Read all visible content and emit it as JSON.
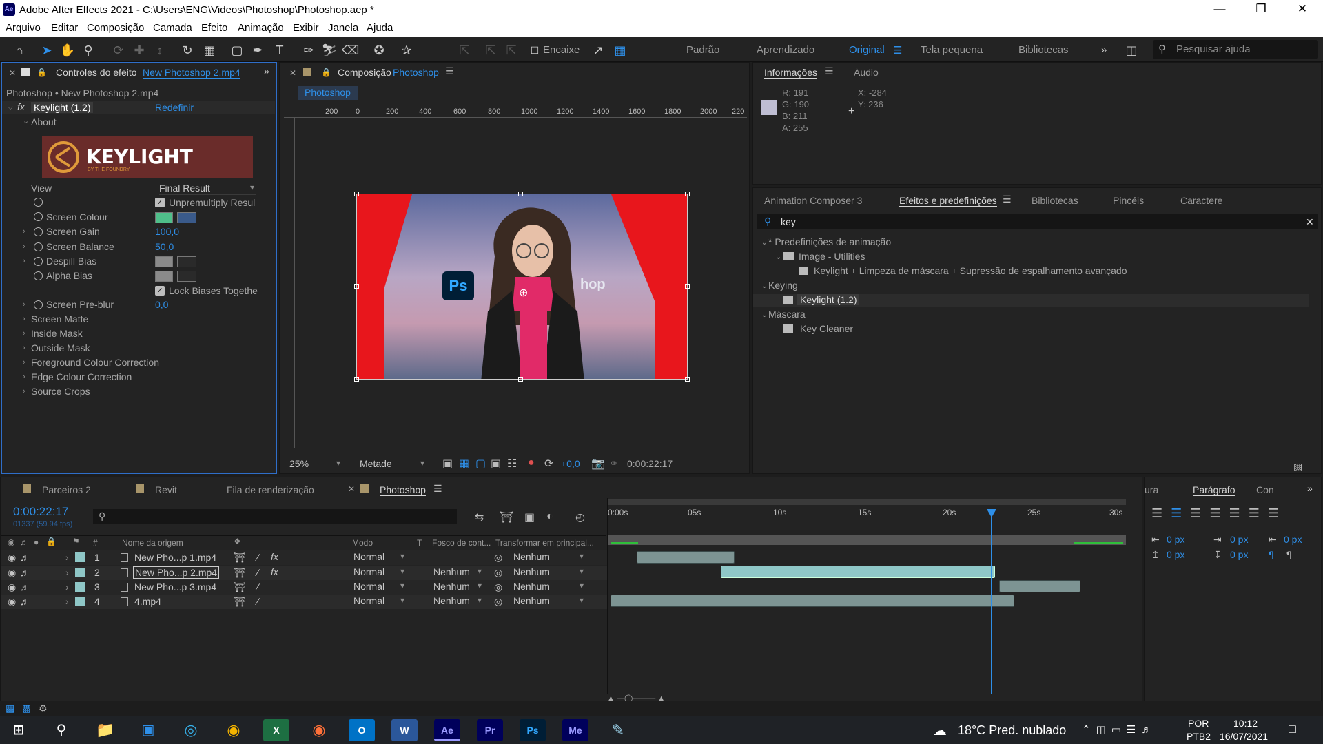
{
  "window": {
    "title": "Adobe After Effects 2021 - C:\\Users\\ENG\\Videos\\Photoshop\\Photoshop.aep *",
    "app_icon": "Ae"
  },
  "menu": [
    "Arquivo",
    "Editar",
    "Composição",
    "Camada",
    "Efeito",
    "Animação",
    "Exibir",
    "Janela",
    "Ajuda"
  ],
  "workspaces": {
    "items": [
      "Padrão",
      "Aprendizado",
      "Original",
      "Tela pequena",
      "Bibliotecas"
    ],
    "active": "Original"
  },
  "toolbar": {
    "snap_label": "Encaixe",
    "search_placeholder": "Pesquisar ajuda"
  },
  "effect_controls": {
    "tab_prefix": "Controles do efeito",
    "tab_file": "New Photoshop 2.mp4",
    "breadcrumb": "Photoshop • New Photoshop 2.mp4",
    "effect_name": "Keylight (1.2)",
    "reset": "Redefinir",
    "about": "About",
    "logo_text": "KEYLIGHT",
    "logo_sub": "BY THE FOUNDRY",
    "view_label": "View",
    "view_value": "Final Result",
    "unpremultiply": "Unpremultiply Resul",
    "screen_colour": "Screen Colour",
    "screen_gain": "Screen Gain",
    "screen_gain_val": "100,0",
    "screen_balance": "Screen Balance",
    "screen_balance_val": "50,0",
    "despill_bias": "Despill Bias",
    "alpha_bias": "Alpha Bias",
    "lock_biases": "Lock Biases Togethe",
    "screen_preblur": "Screen Pre-blur",
    "screen_preblur_val": "0,0",
    "groups": [
      "Screen Matte",
      "Inside Mask",
      "Outside Mask",
      "Foreground Colour Correction",
      "Edge Colour Correction",
      "Source Crops"
    ],
    "screen_colour_hex": "#4fbf8a"
  },
  "composition": {
    "tab_prefix": "Composição",
    "tab_name": "Photoshop",
    "sub_tab": "Photoshop",
    "ruler_labels": [
      "200",
      "0",
      "200",
      "400",
      "600",
      "800",
      "1000",
      "1200",
      "1400",
      "1600",
      "1800",
      "2000",
      "220"
    ],
    "zoom": "25%",
    "resolution": "Metade",
    "exposure": "+0,0",
    "timecode": "0:00:22:17",
    "ps_badge": "Ps",
    "overlay_text": "hop"
  },
  "info": {
    "tabs": [
      "Informações",
      "Áudio"
    ],
    "r": "R:  191",
    "g": "G:  190",
    "b": "B:  211",
    "a": "A:  255",
    "x": "X:  -284",
    "y": "Y:  236",
    "sample_color": "#bfbed3"
  },
  "effects_panel": {
    "tabs": [
      "Animation Composer 3",
      "Efeitos e predefinições",
      "Bibliotecas",
      "Pincéis",
      "Caractere"
    ],
    "search": "key",
    "tree": [
      {
        "label": "* Predefinições de animação",
        "level": 0
      },
      {
        "label": "Image - Utilities",
        "level": 1
      },
      {
        "label": "Keylight + Limpeza de máscara + Supressão de espalhamento avançado",
        "level": 2
      },
      {
        "label": "Keying",
        "level": 0
      },
      {
        "label": "Keylight (1.2)",
        "level": 2
      },
      {
        "label": "Máscara",
        "level": 0
      },
      {
        "label": "Key Cleaner",
        "level": 2
      }
    ]
  },
  "timeline": {
    "tabs": [
      "Parceiros 2",
      "Revit",
      "Fila de renderização",
      "Photoshop"
    ],
    "timecode": "0:00:22:17",
    "frames": "01337 (59.94 fps)",
    "columns": {
      "source": "Nome da origem",
      "mode": "Modo",
      "t": "T",
      "matte": "Fosco de cont...",
      "parent": "Transformar em principal..."
    },
    "ruler": [
      "0:00s",
      "05s",
      "10s",
      "15s",
      "20s",
      "25s",
      "30s"
    ],
    "layers": [
      {
        "num": "1",
        "name": "New Pho...p 1.mp4",
        "mode": "Normal",
        "matte": "",
        "parent": "Nenhum",
        "fx": "fx"
      },
      {
        "num": "2",
        "name": "New Pho...p 2.mp4",
        "mode": "Normal",
        "matte": "Nenhum",
        "parent": "Nenhum",
        "fx": "fx"
      },
      {
        "num": "3",
        "name": "New Pho...p 3.mp4",
        "mode": "Normal",
        "matte": "Nenhum",
        "parent": "Nenhum",
        "fx": ""
      },
      {
        "num": "4",
        "name": "4.mp4",
        "mode": "Normal",
        "matte": "Nenhum",
        "parent": "Nenhum",
        "fx": ""
      }
    ],
    "layer_color": "#8fc7c7",
    "playhead_color": "#2e8fe8"
  },
  "paragraph": {
    "tabs": [
      "ura",
      "Parágrafo",
      "Con"
    ],
    "fields": [
      "0 px",
      "0 px",
      "0 px",
      "0 px",
      "0 px"
    ]
  },
  "taskbar": {
    "weather": "18°C  Pred. nublado",
    "lang1": "POR",
    "lang2": "PTB2",
    "time": "10:12",
    "date": "16/07/2021",
    "apps": [
      "Ae",
      "Pr",
      "Ps",
      "Me"
    ]
  }
}
